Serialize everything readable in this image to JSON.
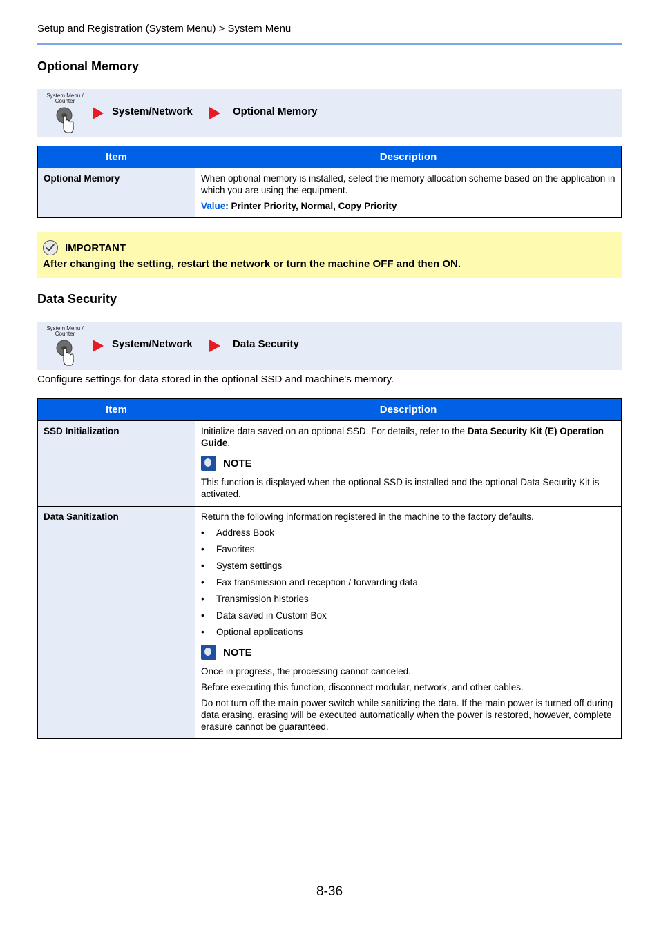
{
  "header": {
    "breadcrumb": "Setup and Registration (System Menu) > System Menu"
  },
  "sections": [
    {
      "title": "Optional Memory",
      "nav": {
        "key_label_line1": "System Menu /",
        "key_label_line2": "Counter",
        "steps": [
          "System/Network",
          "Optional Memory"
        ]
      },
      "table": {
        "headers": [
          "Item",
          "Description"
        ],
        "rows": [
          {
            "item": "Optional Memory",
            "description": "When optional memory is installed, select the memory allocation scheme based on the application in which you are using the equipment.",
            "value_label": "Value",
            "value_text": ": Printer Priority, Normal, Copy Priority"
          }
        ]
      },
      "important": {
        "label": "IMPORTANT",
        "text": "After changing the setting, restart the network or turn the machine OFF and then ON."
      }
    },
    {
      "title": "Data Security",
      "nav": {
        "key_label_line1": "System Menu /",
        "key_label_line2": "Counter",
        "steps": [
          "System/Network",
          "Data Security"
        ]
      },
      "intro": "Configure settings for data stored in the optional SSD and machine's memory.",
      "table": {
        "headers": [
          "Item",
          "Description"
        ],
        "rows": [
          {
            "item": "SSD Initialization",
            "desc_pre": "Initialize data saved on an optional SSD. For details, refer to the ",
            "desc_bold": "Data Security Kit (E) Operation Guide",
            "desc_post": ".",
            "note_label": "NOTE",
            "note_text": "This function is displayed when the optional SSD is installed and the optional Data Security Kit is activated."
          },
          {
            "item": "Data Sanitization",
            "description": "Return the following information registered in the machine to the factory defaults.",
            "bullets": [
              "Address Book",
              "Favorites",
              "System settings",
              "Fax transmission and reception / forwarding data",
              "Transmission histories",
              "Data saved in Custom Box",
              "Optional applications"
            ],
            "note_label": "NOTE",
            "notes": [
              "Once in progress, the processing cannot canceled.",
              "Before executing this function, disconnect modular, network, and other cables.",
              "Do not turn off the main power switch while sanitizing the data. If the main power is turned off during data erasing, erasing will be executed automatically when the power is restored, however, complete erasure cannot be guaranteed."
            ]
          }
        ]
      }
    }
  ],
  "footer": {
    "page_number": "8-36"
  },
  "colors": {
    "table_header": "#0060e6",
    "item_cell": "#e6ebf8",
    "nav_bar": "#e6ebf8",
    "arrow": "#e61c24",
    "important_bg": "#fefbb1",
    "header_rule": "#7ba7e8"
  }
}
